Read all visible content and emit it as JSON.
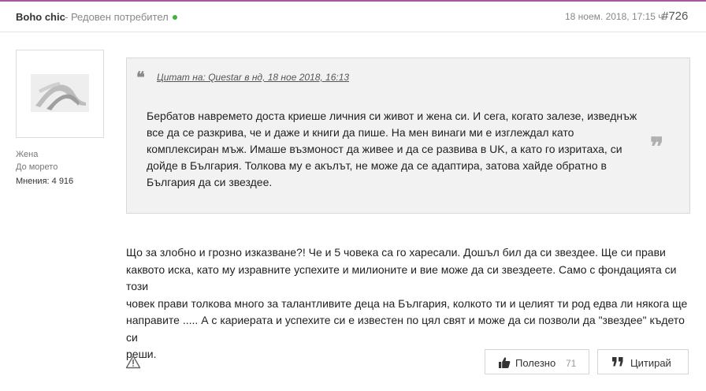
{
  "post": {
    "author": "Boho chic",
    "role": "- Редовен потребител",
    "date": "18 ноем. 2018, 17:15 ч.",
    "number": "#726"
  },
  "profile": {
    "gender": "Жена",
    "location": "До морето",
    "posts": "Мнения: 4 916"
  },
  "quote": {
    "source": "Цитат на: Questar в нд, 18 ное 2018, 16:13",
    "lines": [
      "Бербатов навремето доста криеше личния си живот и жена си. И сега, когато залезе, изведнъж",
      "все да се разкрива, че и даже и книги да пише. На мен винаги ми е изглеждал като",
      "комплексиран мъж. Имаше възмоност да живее и да се развива в UK,  а като го изритаха, си",
      "дойде в България. Толкова му е акълът, не може да се адаптира, затова хайде обратно в",
      "България да си звездее."
    ]
  },
  "body": {
    "lines": [
      "Що за злобно и грозно изказване?! Че и 5 човека са го харесали. Дошъл бил да си звездее. Ще си прави",
      "каквото иска, като му изравните успехите и милионите и вие може да си звездеете. Само с фондацията си този",
      "човек прави толкова много за талантливите деца на България, колкото ти и целият ти род  едва ли някога ще",
      "направите ..... А с кариерата и успехите си е известен по цял свят и може да си позволи да \"звездее\" където си",
      "реши."
    ]
  },
  "actions": {
    "like_label": "Полезно",
    "like_count": "71",
    "quote_label": "Цитирай"
  },
  "icons": {
    "online": "online-dot",
    "quote_open": "quote-open-icon",
    "quote_close": "quote-close-icon",
    "report": "warning-triangle-icon",
    "like": "thumbs-up-icon",
    "quote_button": "quote-icon"
  },
  "colors": {
    "accent": "#a35aa0",
    "online": "#3cb43c",
    "quote_bg": "#f2f2f2"
  }
}
